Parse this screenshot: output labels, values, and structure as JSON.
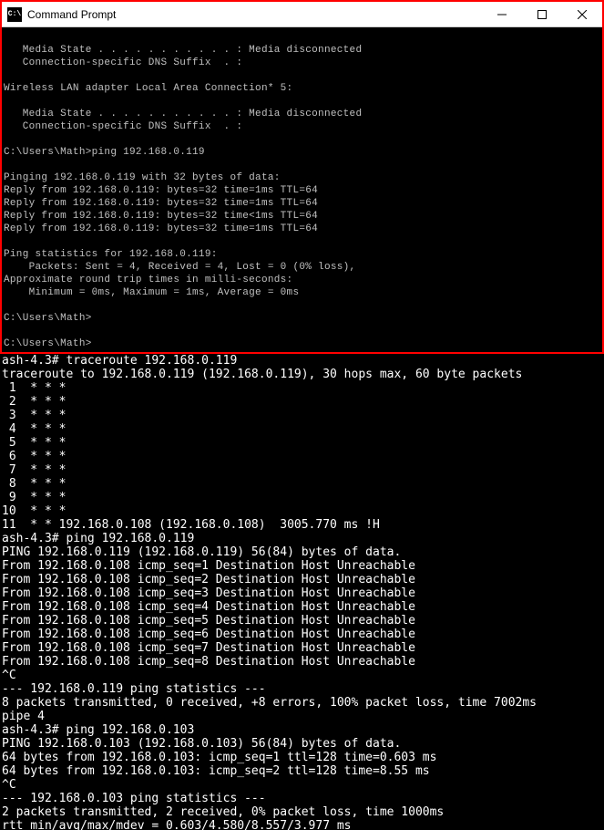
{
  "window": {
    "title": "Command Prompt",
    "icon_label": "C:\\"
  },
  "top_terminal": {
    "lines": [
      "",
      "   Media State . . . . . . . . . . . : Media disconnected",
      "   Connection-specific DNS Suffix  . :",
      "",
      "Wireless LAN adapter Local Area Connection* 5:",
      "",
      "   Media State . . . . . . . . . . . : Media disconnected",
      "   Connection-specific DNS Suffix  . :",
      "",
      "C:\\Users\\Math>ping 192.168.0.119",
      "",
      "Pinging 192.168.0.119 with 32 bytes of data:",
      "Reply from 192.168.0.119: bytes=32 time=1ms TTL=64",
      "Reply from 192.168.0.119: bytes=32 time=1ms TTL=64",
      "Reply from 192.168.0.119: bytes=32 time<1ms TTL=64",
      "Reply from 192.168.0.119: bytes=32 time=1ms TTL=64",
      "",
      "Ping statistics for 192.168.0.119:",
      "    Packets: Sent = 4, Received = 4, Lost = 0 (0% loss),",
      "Approximate round trip times in milli-seconds:",
      "    Minimum = 0ms, Maximum = 1ms, Average = 0ms",
      "",
      "C:\\Users\\Math>",
      "",
      "C:\\Users\\Math>"
    ]
  },
  "bottom_terminal": {
    "lines": [
      "ash-4.3# traceroute 192.168.0.119",
      "traceroute to 192.168.0.119 (192.168.0.119), 30 hops max, 60 byte packets",
      " 1  * * *",
      " 2  * * *",
      " 3  * * *",
      " 4  * * *",
      " 5  * * *",
      " 6  * * *",
      " 7  * * *",
      " 8  * * *",
      " 9  * * *",
      "10  * * *",
      "11  * * 192.168.0.108 (192.168.0.108)  3005.770 ms !H",
      "ash-4.3# ping 192.168.0.119",
      "PING 192.168.0.119 (192.168.0.119) 56(84) bytes of data.",
      "From 192.168.0.108 icmp_seq=1 Destination Host Unreachable",
      "From 192.168.0.108 icmp_seq=2 Destination Host Unreachable",
      "From 192.168.0.108 icmp_seq=3 Destination Host Unreachable",
      "From 192.168.0.108 icmp_seq=4 Destination Host Unreachable",
      "From 192.168.0.108 icmp_seq=5 Destination Host Unreachable",
      "From 192.168.0.108 icmp_seq=6 Destination Host Unreachable",
      "From 192.168.0.108 icmp_seq=7 Destination Host Unreachable",
      "From 192.168.0.108 icmp_seq=8 Destination Host Unreachable",
      "^C",
      "--- 192.168.0.119 ping statistics ---",
      "8 packets transmitted, 0 received, +8 errors, 100% packet loss, time 7002ms",
      "pipe 4",
      "ash-4.3# ping 192.168.0.103",
      "PING 192.168.0.103 (192.168.0.103) 56(84) bytes of data.",
      "64 bytes from 192.168.0.103: icmp_seq=1 ttl=128 time=0.603 ms",
      "64 bytes from 192.168.0.103: icmp_seq=2 ttl=128 time=8.55 ms",
      "^C",
      "--- 192.168.0.103 ping statistics ---",
      "2 packets transmitted, 2 received, 0% packet loss, time 1000ms",
      "rtt min/avg/max/mdev = 0.603/4.580/8.557/3.977 ms"
    ],
    "prompt": "ash-4.3# "
  }
}
